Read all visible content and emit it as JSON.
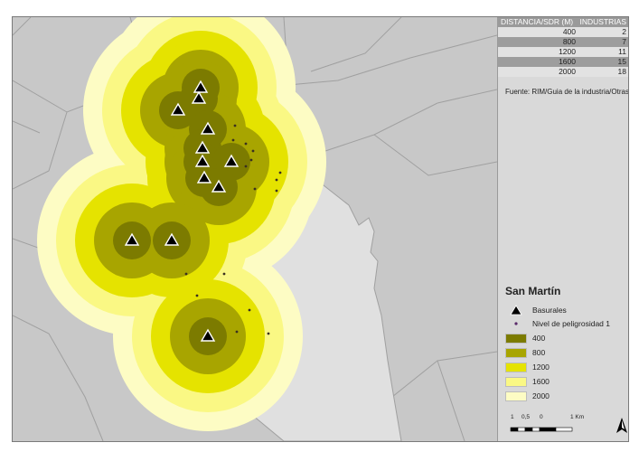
{
  "colors": {
    "ring_400": "#7c7b00",
    "ring_800": "#a8a500",
    "ring_1200": "#e5e300",
    "ring_1600": "#faf884",
    "ring_2000": "#fdfcc4",
    "background_area": "#c8c8c8",
    "focus_area": "#e0e0e0",
    "boundary": "#9a9a9a",
    "industry_point": "#3a3020"
  },
  "table": {
    "headers": [
      "DISTANCIA/SDR (M)",
      "INDUSTRIAS"
    ],
    "rows": [
      {
        "distance": "400",
        "count": "2"
      },
      {
        "distance": "800",
        "count": "7"
      },
      {
        "distance": "1200",
        "count": "11"
      },
      {
        "distance": "1600",
        "count": "15"
      },
      {
        "distance": "2000",
        "count": "18"
      }
    ]
  },
  "source": "Fuente: RIM/Guia de la industria/Otras",
  "legend": {
    "title": "San Martín",
    "basurales": "Basurales",
    "nivel": "Nivel de peligrosidad 1",
    "rings": [
      {
        "label": "400",
        "color": "#7c7b00"
      },
      {
        "label": "800",
        "color": "#a8a500"
      },
      {
        "label": "1200",
        "color": "#e5e300"
      },
      {
        "label": "1600",
        "color": "#faf884"
      },
      {
        "label": "2000",
        "color": "#fdfcc4"
      }
    ]
  },
  "scale": {
    "labels": [
      "1",
      "0,5",
      "0",
      "1 Km"
    ]
  }
}
